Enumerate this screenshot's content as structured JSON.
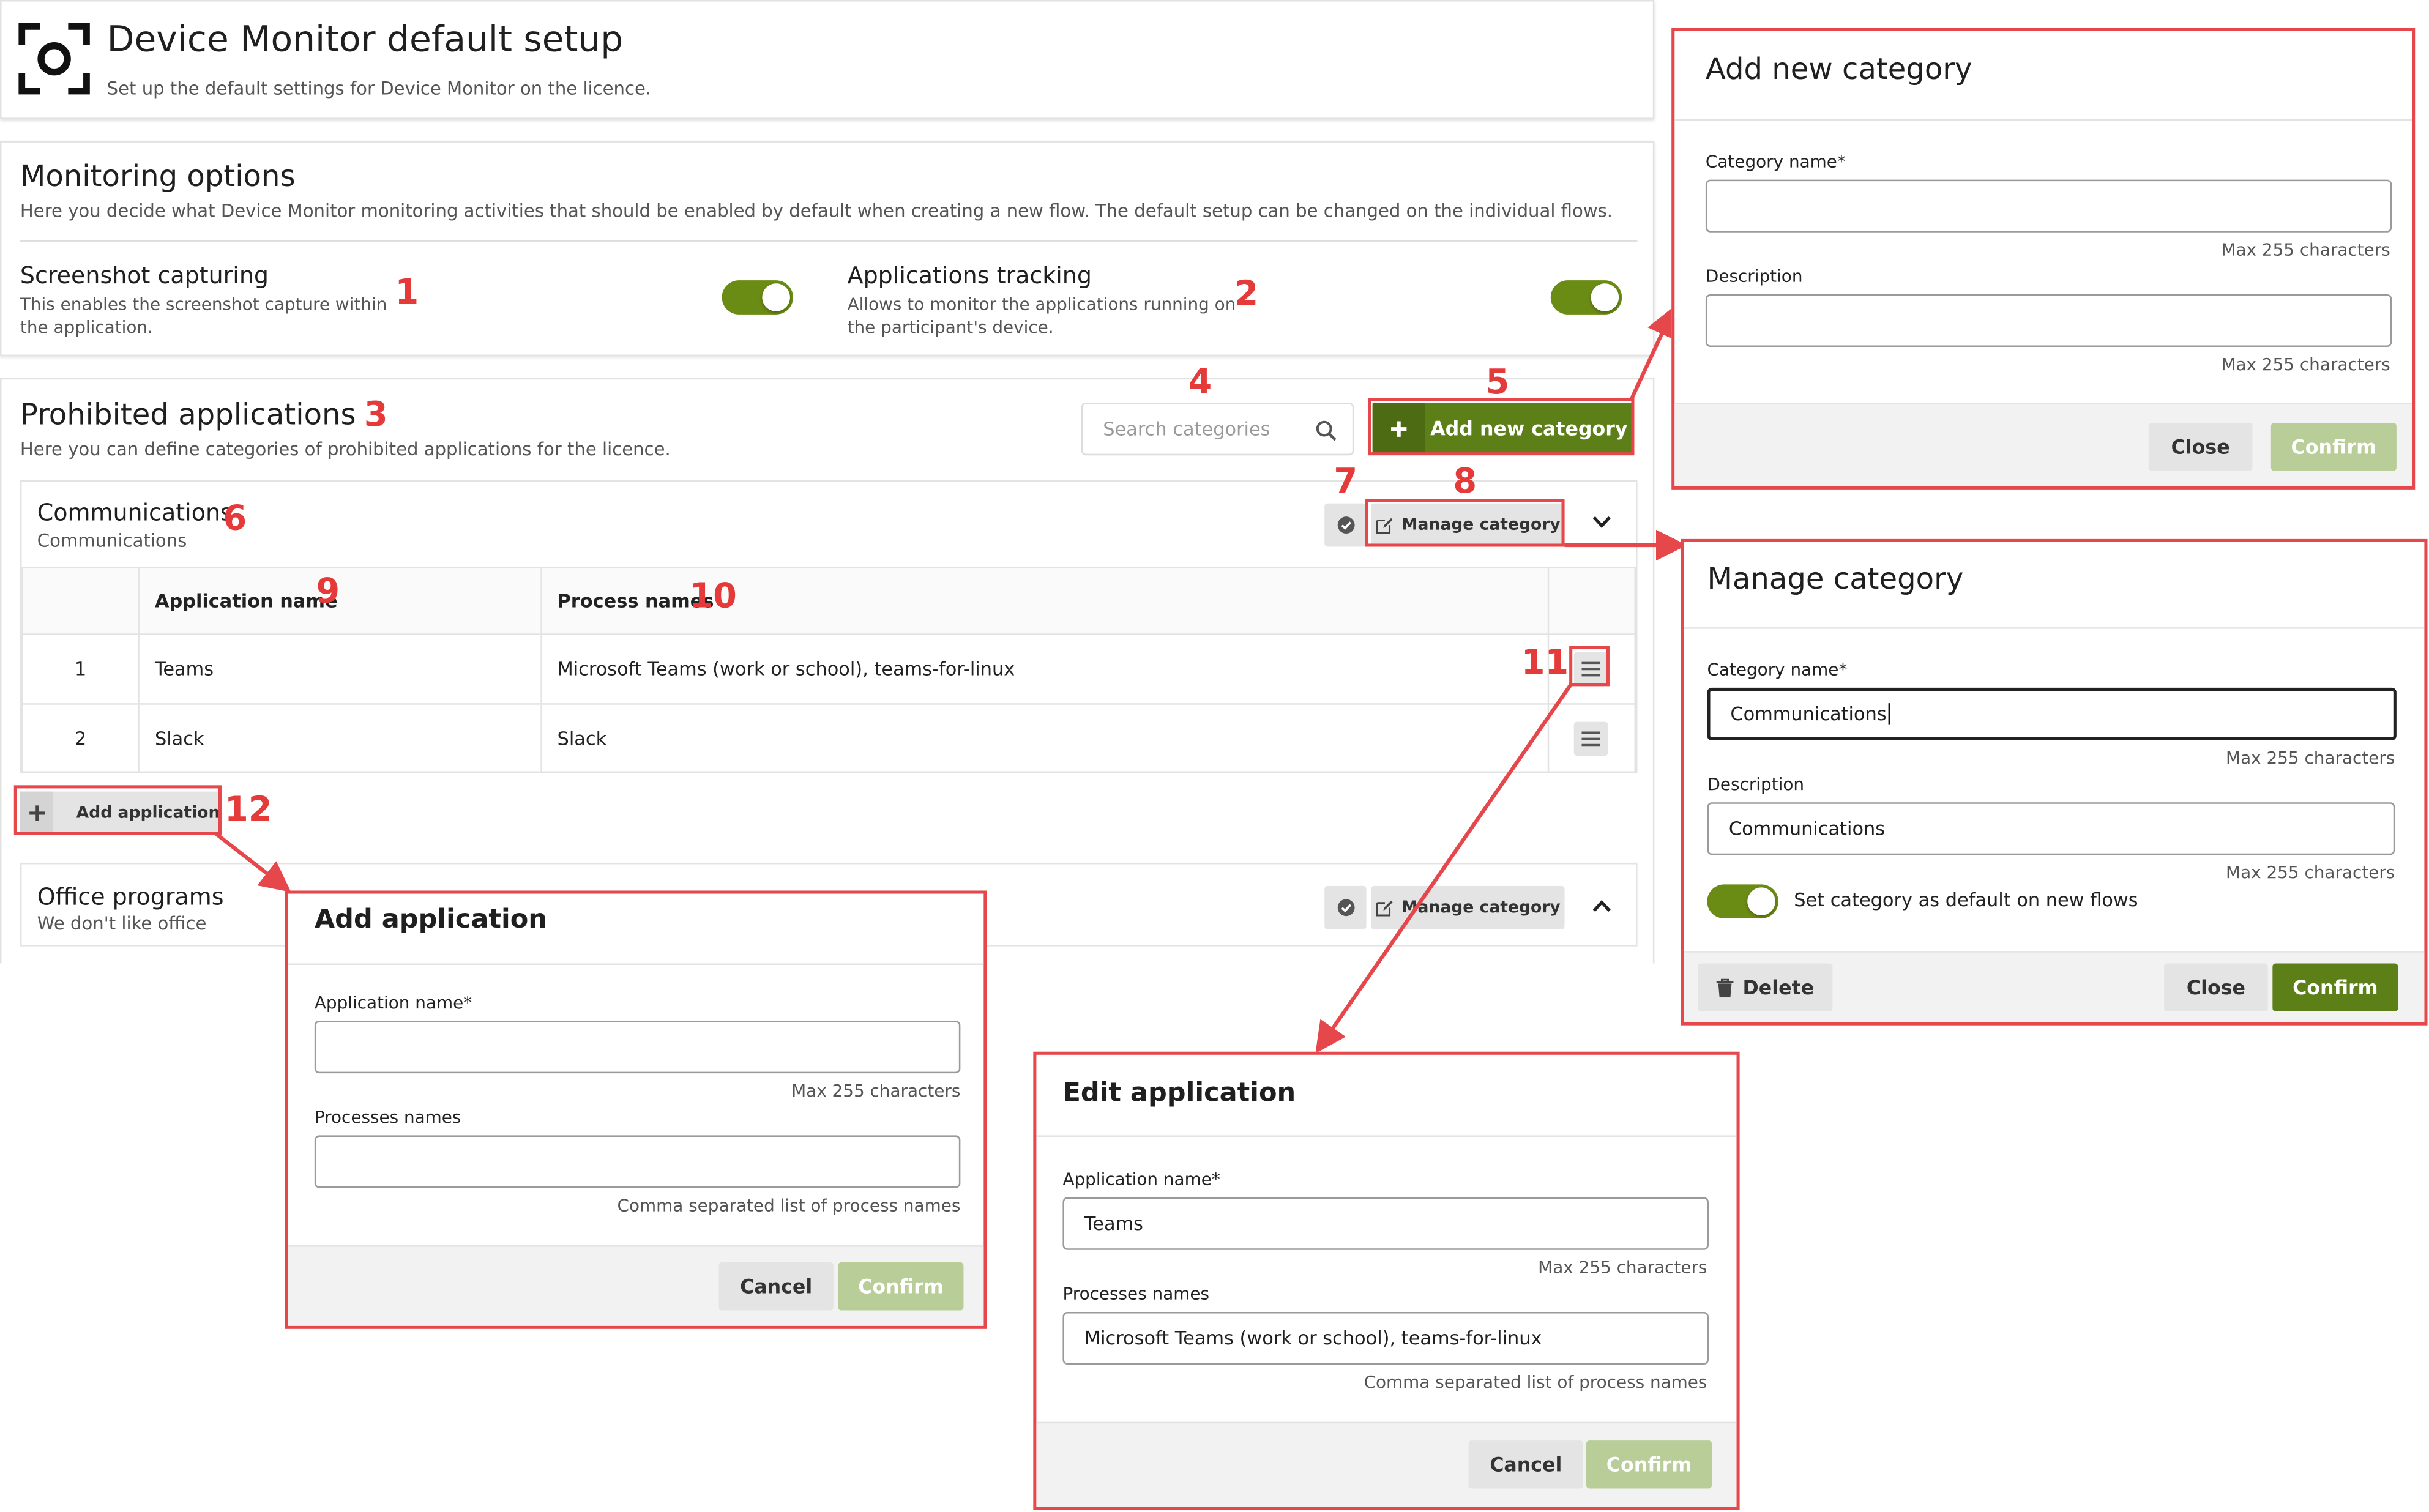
{
  "header": {
    "title": "Device Monitor default setup",
    "subtitle": "Set up the default settings for Device Monitor on the licence."
  },
  "monitoring": {
    "title": "Monitoring options",
    "description": "Here you decide what Device Monitor monitoring activities that should be enabled by default when creating a new flow. The default setup can be changed on the individual flows.",
    "screenshot": {
      "label": "Screenshot capturing",
      "description_1": "This enables the screenshot capture within",
      "description_2": "the application.",
      "enabled": true
    },
    "applications_tracking": {
      "label": "Applications tracking",
      "description_1": "Allows to monitor the applications running on",
      "description_2": "the participant's device.",
      "enabled": true
    }
  },
  "prohibited": {
    "title": "Prohibited applications",
    "description": "Here you can define categories of prohibited applications for the licence.",
    "search_placeholder": "Search categories",
    "add_category_label": "Add new category",
    "categories": [
      {
        "name": "Communications",
        "description": "Communications",
        "manage_label": "Manage category",
        "columns": [
          "Application name",
          "Process names"
        ],
        "rows": [
          {
            "index": "1",
            "app": "Teams",
            "processes": "Microsoft Teams (work or school), teams-for-linux"
          },
          {
            "index": "2",
            "app": "Slack",
            "processes": "Slack"
          }
        ],
        "add_application_label": "Add application"
      },
      {
        "name": "Office programs",
        "description": "We don't like office",
        "manage_label": "Manage category"
      }
    ]
  },
  "callouts": [
    "1",
    "2",
    "3",
    "4",
    "5",
    "6",
    "7",
    "8",
    "9",
    "10",
    "11",
    "12"
  ],
  "modal_add_category": {
    "title": "Add new category",
    "name_label": "Category name*",
    "name_value": "",
    "name_hint": "Max 255 characters",
    "desc_label": "Description",
    "desc_value": "",
    "desc_hint": "Max 255 characters",
    "close_label": "Close",
    "confirm_label": "Confirm"
  },
  "modal_manage_category": {
    "title": "Manage category",
    "name_label": "Category name*",
    "name_value": "Communications",
    "name_hint": "Max 255 characters",
    "desc_label": "Description",
    "desc_value": "Communications",
    "desc_hint": "Max 255 characters",
    "default_toggle_label": "Set category as default on new flows",
    "default_toggle_on": true,
    "delete_label": "Delete",
    "close_label": "Close",
    "confirm_label": "Confirm"
  },
  "modal_add_application": {
    "title": "Add application",
    "name_label": "Application name*",
    "name_value": "",
    "name_hint": "Max 255 characters",
    "proc_label": "Processes names",
    "proc_value": "",
    "proc_hint": "Comma separated list of process names",
    "cancel_label": "Cancel",
    "confirm_label": "Confirm"
  },
  "modal_edit_application": {
    "title": "Edit application",
    "name_label": "Application name*",
    "name_value": "Teams",
    "name_hint": "Max 255 characters",
    "proc_label": "Processes names",
    "proc_value": "Microsoft Teams (work or school), teams-for-linux",
    "proc_hint": "Comma separated list of process names",
    "cancel_label": "Cancel",
    "confirm_label": "Confirm"
  },
  "colors": {
    "brand_green": "#5c7f17",
    "disabled_green": "#b8cd98",
    "annotation_red": "#e5474b"
  },
  "icons": [
    "camera-focus-icon",
    "search-icon",
    "plus-icon",
    "check-circle-icon",
    "edit-icon",
    "chevron-down-icon",
    "chevron-up-icon",
    "menu-icon",
    "trash-icon"
  ]
}
